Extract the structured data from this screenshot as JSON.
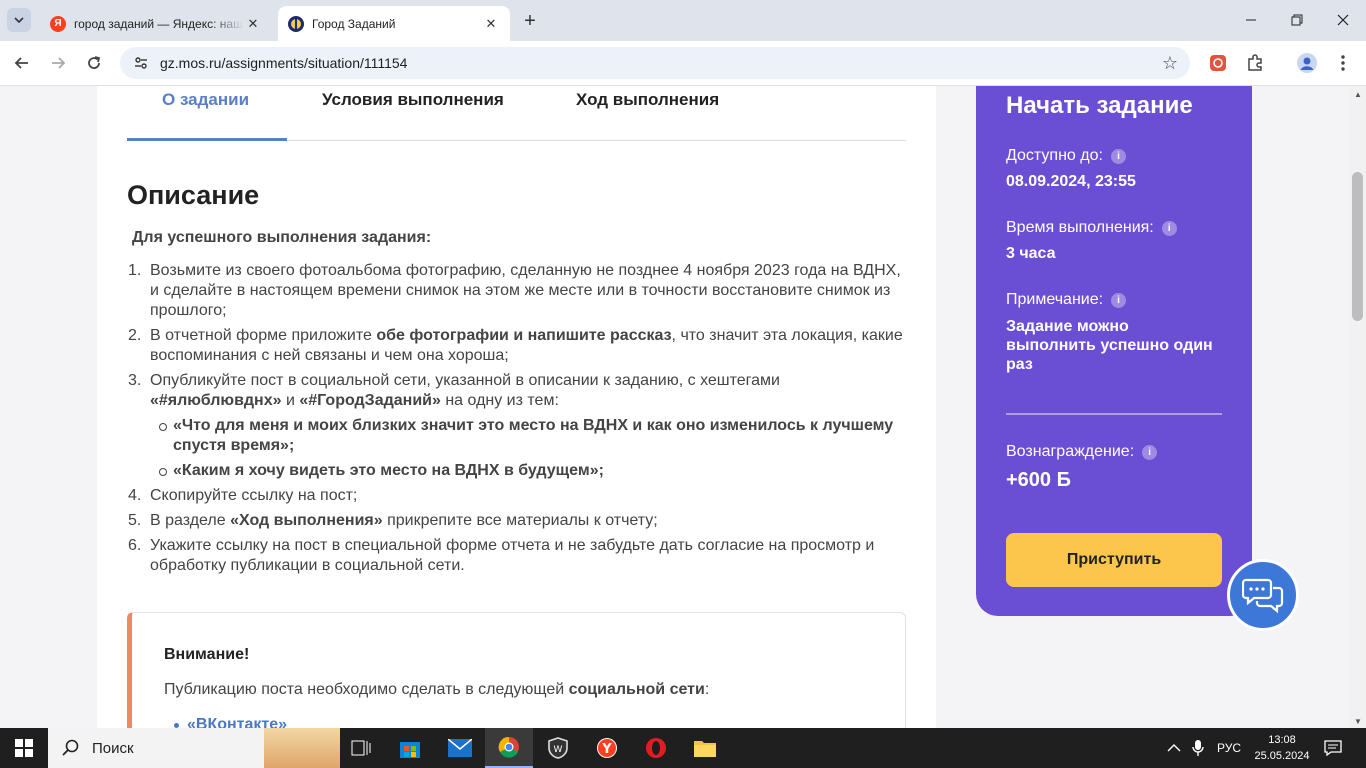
{
  "browser": {
    "tabs": [
      {
        "title": "город заданий — Яндекс: наш",
        "favicon": "Я",
        "active": false
      },
      {
        "title": "Город Заданий",
        "favicon": "gz-logo",
        "active": true
      }
    ],
    "url": "gz.mos.ru/assignments/situation/111154"
  },
  "nav_tabs": [
    "О задании",
    "Условия выполнения",
    "Ход выполнения"
  ],
  "description": {
    "title": "Описание",
    "lead": "Для успешного выполнения задания:",
    "steps": [
      {
        "num": "1.",
        "text": "Возьмите из своего фотоальбома фотографию, сделанную не позднее 4 ноября 2023 года на ВДНХ, и сделайте в настоящем времени снимок на этом же месте или в точности восстановите снимок из прошлого;"
      },
      {
        "num": "2.",
        "pre": "В отчетной форме приложите ",
        "bold": "обе фотографии и напишите рассказ",
        "post": ", что значит эта локация, какие воспоминания с ней связаны и чем она хороша;"
      },
      {
        "num": "3.",
        "pre": "Опубликуйте пост в социальной сети, указанной в описании к заданию, с хештегами ",
        "bold1": "«#ялюблювднх»",
        "mid": " и ",
        "bold2": "«#ГородЗаданий»",
        "post": " на одну из тем:"
      },
      {
        "num": "4.",
        "text": "Скопируйте ссылку на пост;"
      },
      {
        "num": "5.",
        "pre": "В разделе ",
        "bold": "«Ход выполнения»",
        "post": " прикрепите все материалы к отчету;"
      },
      {
        "num": "6.",
        "text": "Укажите ссылку на пост в специальной форме отчета и не забудьте дать согласие на просмотр и обработку публикации в социальной сети."
      }
    ],
    "topics": [
      "«Что для меня и моих близких значит это место на ВДНХ и как оно изменилось к лучшему спустя время»;",
      "«Каким я хочу видеть это место на ВДНХ в будущем»;"
    ]
  },
  "notice": {
    "title": "Внимание!",
    "text_pre": "Публикацию поста необходимо сделать в следующей ",
    "text_bold": "социальной сети",
    "text_post": ":",
    "link": "«ВКонтакте»"
  },
  "sidebar": {
    "title": "Начать задание",
    "available_label": "Доступно до:",
    "available_value": "08.09.2024, 23:55",
    "duration_label": "Время выполнения:",
    "duration_value": "3 часа",
    "note_label": "Примечание:",
    "note_value": "Задание можно выполнить успешно один раз",
    "reward_label": "Вознаграждение:",
    "reward_value": "+600 Б",
    "start_button": "Приступить",
    "info_icon": "i"
  },
  "taskbar": {
    "search_placeholder": "Поиск",
    "language": "РУС",
    "time": "13:08",
    "date": "25.05.2024"
  },
  "colors": {
    "accent_blue": "#5a7fc7",
    "sidebar_purple": "#6a4fd4",
    "button_yellow": "#fbc64b",
    "notice_orange": "#f08a5d"
  }
}
